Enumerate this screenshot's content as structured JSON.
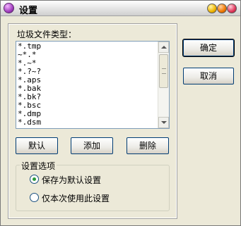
{
  "window": {
    "title": "设置"
  },
  "list": {
    "label": "垃圾文件类型：",
    "items": [
      "*.tmp",
      "~*.*",
      "*.~*",
      "*.?~?",
      "*.aps",
      "*.bak",
      "*.bk?",
      "*.bsc",
      "*.dmp",
      "*.dsm"
    ]
  },
  "list_buttons": {
    "default": "默认",
    "add": "添加",
    "delete": "删除"
  },
  "side_buttons": {
    "ok": "确定",
    "cancel": "取消"
  },
  "options": {
    "group_title": "设置选项",
    "save_default": "保存为默认设置",
    "use_once": "仅本次使用此设置",
    "selected": "save_default"
  }
}
